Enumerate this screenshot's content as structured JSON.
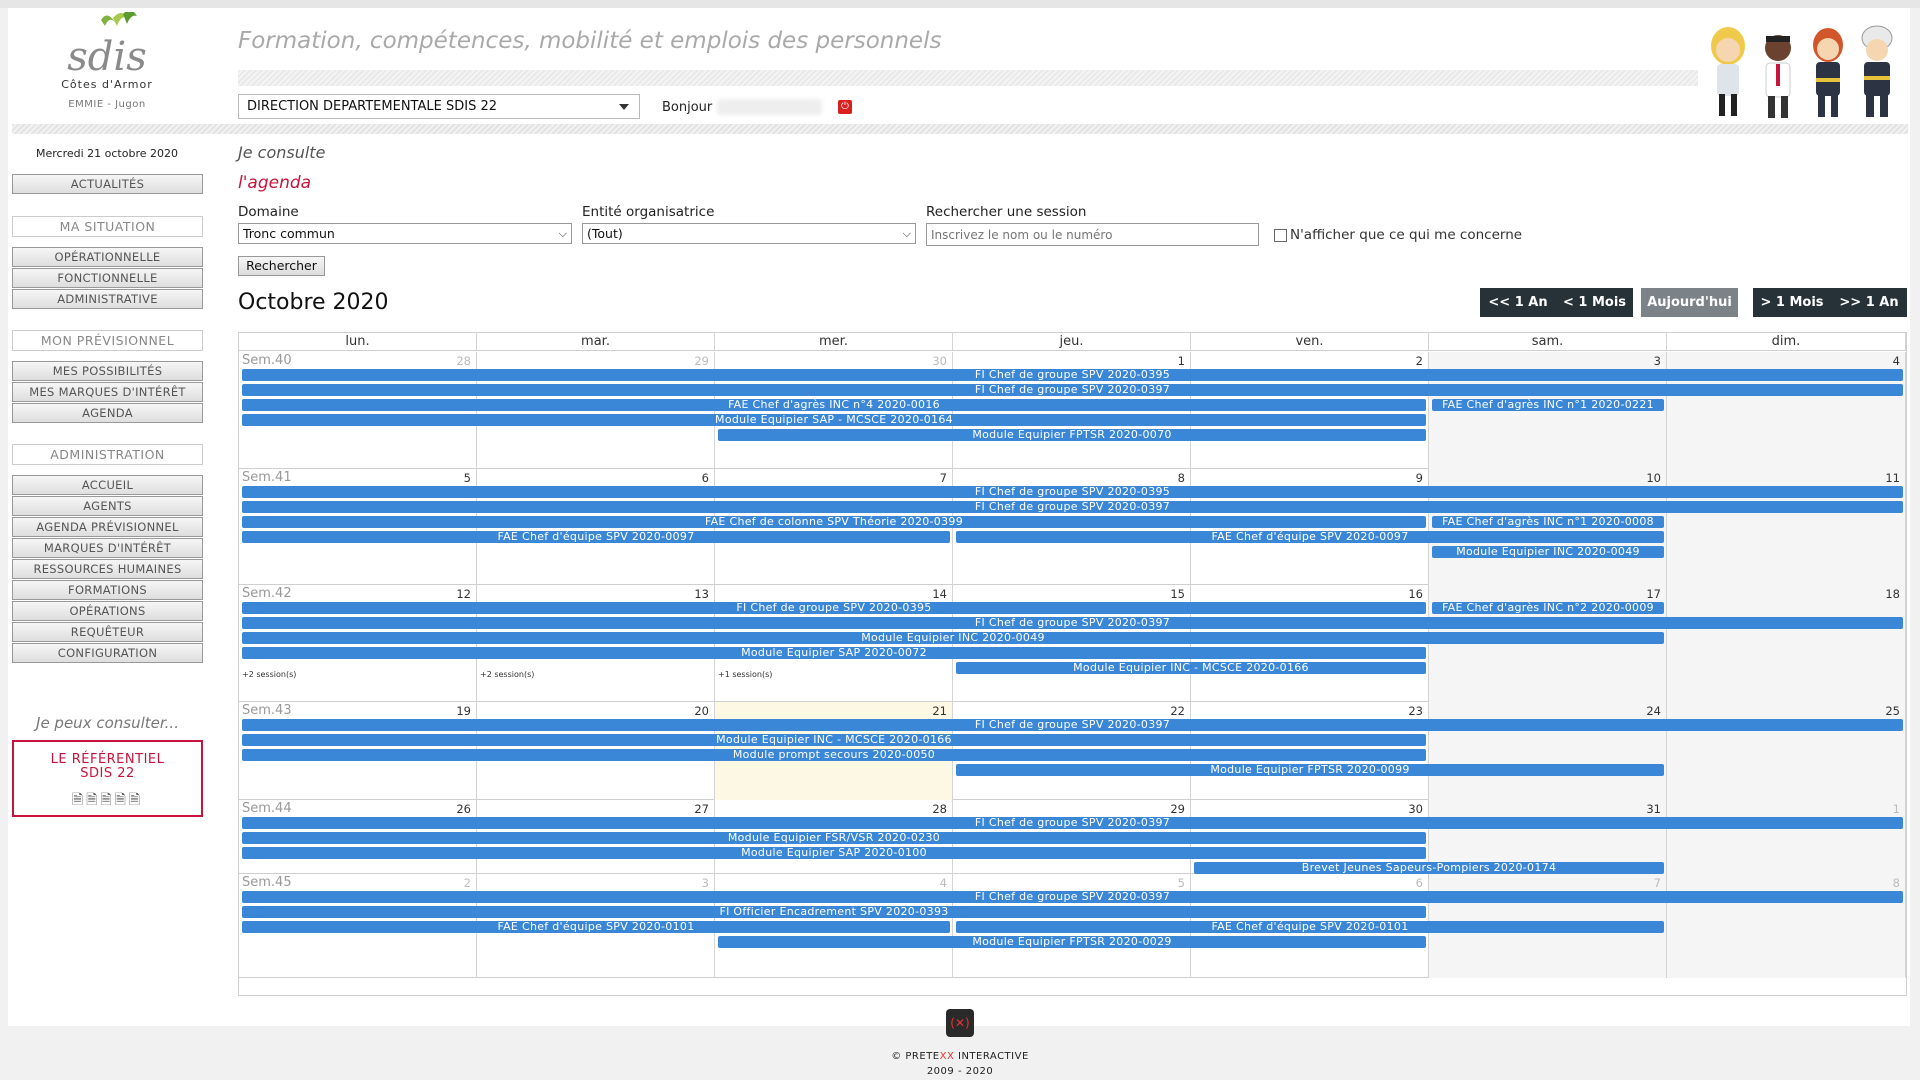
{
  "header": {
    "logo_dept": "Côtes d'Armor",
    "logo_site": "EMMIE - Jugon",
    "tagline": "Formation, compétences, mobilité et emplois des personnels",
    "direction": "DIRECTION DEPARTEMENTALE SDIS 22",
    "greeting": "Bonjour"
  },
  "sidebar": {
    "date": "Mercredi 21 octobre 2020",
    "actualites": "ACTUALITÉS",
    "ma_situation": "MA SITUATION",
    "situation_items": [
      "OPÉRATIONNELLE",
      "FONCTIONNELLE",
      "ADMINISTRATIVE"
    ],
    "mon_previsionnel": "MON PRÉVISIONNEL",
    "previsionnel_items": [
      "MES POSSIBILITÉS",
      "MES MARQUES D'INTÉRÊT",
      "AGENDA"
    ],
    "administration": "ADMINISTRATION",
    "admin_items": [
      "ACCUEIL",
      "AGENTS",
      "AGENDA PRÉVISIONNEL",
      "MARQUES D'INTÉRÊT",
      "RESSOURCES HUMAINES",
      "FORMATIONS",
      "OPÉRATIONS",
      "REQUÊTEUR",
      "CONFIGURATION"
    ],
    "consult_label": "Je peux consulter...",
    "ref_line1": "LE RÉFÉRENTIEL",
    "ref_line2": "SDIS 22"
  },
  "main": {
    "je_consulte": "Je consulte",
    "agenda_title": "l'agenda",
    "domaine_label": "Domaine",
    "domaine_value": "Tronc commun",
    "entite_label": "Entité organisatrice",
    "entite_value": "(Tout)",
    "search_label": "Rechercher une session",
    "search_placeholder": "Inscrivez le nom ou le numéro",
    "only_mine_label": "N'afficher que ce qui me concerne",
    "search_button": "Rechercher",
    "month_title": "Octobre 2020",
    "nav": {
      "prev_year": "<< 1 An",
      "prev_month": "< 1 Mois",
      "today": "Aujourd'hui",
      "next_month": "> 1 Mois",
      "next_year": ">> 1 An"
    }
  },
  "calendar": {
    "day_headers": [
      "lun.",
      "mar.",
      "mer.",
      "jeu.",
      "ven.",
      "sam.",
      "dim."
    ],
    "today_day": 21,
    "weeks": [
      {
        "label": "Sem.40",
        "days": [
          28,
          29,
          30,
          1,
          2,
          3,
          4
        ],
        "first_current": 3,
        "last_current": 6,
        "events": [
          {
            "t": "FI Chef de groupe SPV 2020-0395",
            "s": 0,
            "e": 6,
            "r": 0
          },
          {
            "t": "FI Chef de groupe SPV 2020-0397",
            "s": 0,
            "e": 6,
            "r": 1
          },
          {
            "t": "FAE Chef d'agrès INC n°4 2020-0016",
            "s": 0,
            "e": 4,
            "r": 2
          },
          {
            "t": "FAE Chef d'agrès INC n°1 2020-0221",
            "s": 5,
            "e": 5,
            "r": 2
          },
          {
            "t": "Module Equipier SAP - MCSCE 2020-0164",
            "s": 0,
            "e": 4,
            "r": 3
          },
          {
            "t": "Module Equipier FPTSR 2020-0070",
            "s": 2,
            "e": 4,
            "r": 4
          }
        ],
        "more": []
      },
      {
        "label": "Sem.41",
        "days": [
          5,
          6,
          7,
          8,
          9,
          10,
          11
        ],
        "first_current": 0,
        "last_current": 6,
        "events": [
          {
            "t": "FI Chef de groupe SPV 2020-0395",
            "s": 0,
            "e": 6,
            "r": 0
          },
          {
            "t": "FI Chef de groupe SPV 2020-0397",
            "s": 0,
            "e": 6,
            "r": 1
          },
          {
            "t": "FAE Chef de colonne SPV Théorie 2020-0399",
            "s": 0,
            "e": 4,
            "r": 2
          },
          {
            "t": "FAE Chef d'agrès INC n°1 2020-0008",
            "s": 5,
            "e": 5,
            "r": 2
          },
          {
            "t": "FAE Chef d'équipe SPV 2020-0097",
            "s": 0,
            "e": 2,
            "r": 3
          },
          {
            "t": "FAE Chef d'équipe SPV 2020-0097",
            "s": 3,
            "e": 5,
            "r": 3
          },
          {
            "t": "Module Equipier INC 2020-0049",
            "s": 5,
            "e": 5,
            "r": 4
          }
        ],
        "more": []
      },
      {
        "label": "Sem.42",
        "days": [
          12,
          13,
          14,
          15,
          16,
          17,
          18
        ],
        "first_current": 0,
        "last_current": 6,
        "events": [
          {
            "t": "FI Chef de groupe SPV 2020-0395",
            "s": 0,
            "e": 4,
            "r": 0
          },
          {
            "t": "FAE Chef d'agrès INC n°2 2020-0009",
            "s": 5,
            "e": 5,
            "r": 0
          },
          {
            "t": "FI Chef de groupe SPV 2020-0397",
            "s": 0,
            "e": 6,
            "r": 1
          },
          {
            "t": "Module Equipier INC 2020-0049",
            "s": 0,
            "e": 5,
            "r": 2
          },
          {
            "t": "Module Equipier SAP 2020-0072",
            "s": 0,
            "e": 4,
            "r": 3
          },
          {
            "t": "Module Equipier INC - MCSCE 2020-0166",
            "s": 3,
            "e": 4,
            "r": 4
          }
        ],
        "more": [
          {
            "d": 0,
            "t": "+2 session(s)"
          },
          {
            "d": 1,
            "t": "+2 session(s)"
          },
          {
            "d": 2,
            "t": "+1 session(s)"
          }
        ]
      },
      {
        "label": "Sem.43",
        "days": [
          19,
          20,
          21,
          22,
          23,
          24,
          25
        ],
        "first_current": 0,
        "last_current": 6,
        "events": [
          {
            "t": "FI Chef de groupe SPV 2020-0397",
            "s": 0,
            "e": 6,
            "r": 0
          },
          {
            "t": "Module Equipier INC - MCSCE 2020-0166",
            "s": 0,
            "e": 4,
            "r": 1
          },
          {
            "t": "Module prompt secours 2020-0050",
            "s": 0,
            "e": 4,
            "r": 2
          },
          {
            "t": "Module Equipier FPTSR 2020-0099",
            "s": 3,
            "e": 5,
            "r": 3
          }
        ],
        "more": []
      },
      {
        "label": "Sem.44",
        "days": [
          26,
          27,
          28,
          29,
          30,
          31,
          1
        ],
        "first_current": 0,
        "last_current": 5,
        "events": [
          {
            "t": "FI Chef de groupe SPV 2020-0397",
            "s": 0,
            "e": 6,
            "r": 0
          },
          {
            "t": "Module Equipier FSR/VSR 2020-0230",
            "s": 0,
            "e": 4,
            "r": 1
          },
          {
            "t": "Module Equipier SAP 2020-0100",
            "s": 0,
            "e": 4,
            "r": 2
          },
          {
            "t": "Brevet Jeunes Sapeurs-Pompiers 2020-0174",
            "s": 4,
            "e": 5,
            "r": 3
          }
        ],
        "more": []
      },
      {
        "label": "Sem.45",
        "days": [
          2,
          3,
          4,
          5,
          6,
          7,
          8
        ],
        "first_current": 7,
        "last_current": -1,
        "events": [
          {
            "t": "FI Chef de groupe SPV 2020-0397",
            "s": 0,
            "e": 6,
            "r": 0
          },
          {
            "t": "FI Officier Encadrement SPV 2020-0393",
            "s": 0,
            "e": 4,
            "r": 1
          },
          {
            "t": "FAE Chef d'équipe SPV 2020-0101",
            "s": 0,
            "e": 2,
            "r": 2
          },
          {
            "t": "FAE Chef d'équipe SPV 2020-0101",
            "s": 3,
            "e": 5,
            "r": 2
          },
          {
            "t": "Module Equipier FPTSR 2020-0029",
            "s": 2,
            "e": 4,
            "r": 3
          }
        ],
        "more": []
      }
    ]
  },
  "footer": {
    "copy_pre": "© PRETE",
    "copy_xx": "XX",
    "copy_post": " INTERACTIVE",
    "years": "2009 - 2020"
  },
  "colors": {
    "event": "#3a87d8",
    "accent": "#c8143c",
    "nav": "#263238",
    "today_bg": "#fcf8e3"
  }
}
